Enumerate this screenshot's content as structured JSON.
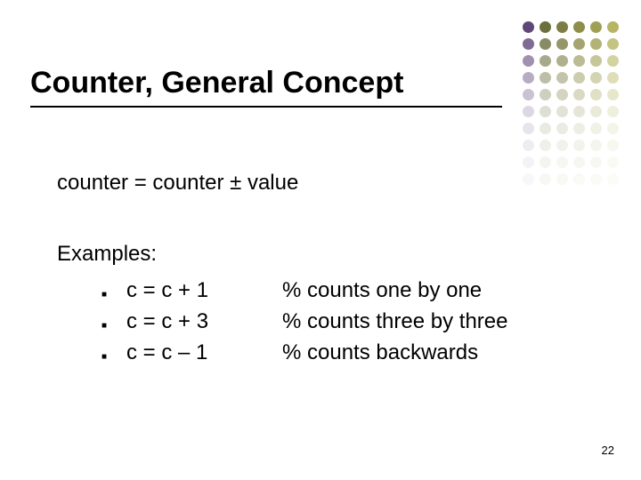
{
  "title": "Counter, General Concept",
  "formula": "counter = counter ±  value",
  "examples_label": "Examples:",
  "examples": [
    {
      "expr": "c = c + 1",
      "comment": "% counts one by one"
    },
    {
      "expr": "c = c + 3",
      "comment": "% counts three by three"
    },
    {
      "expr": "c = c – 1",
      "comment": "% counts backwards"
    }
  ],
  "page_number": "22"
}
